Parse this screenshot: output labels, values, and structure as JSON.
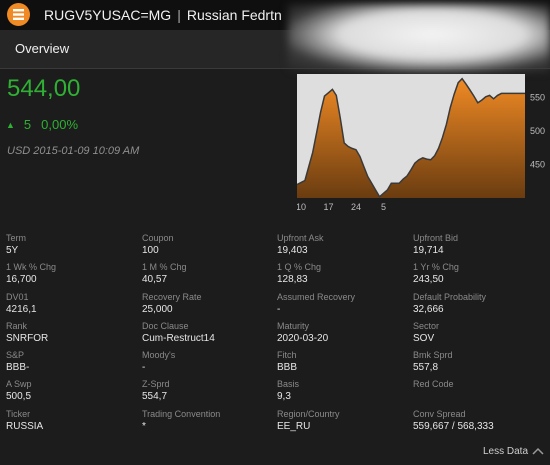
{
  "header": {
    "ticker": "RUGV5YUSAC=MG",
    "separator": "|",
    "name": "Russian Fedrtn"
  },
  "nav": {
    "overview_label": "Overview"
  },
  "quote": {
    "price": "544,00",
    "change": "5",
    "change_pct": "0,00%",
    "timestamp": "USD  2015-01-09 10:09 AM",
    "up_color": "#2fb034"
  },
  "chart_data": {
    "type": "area",
    "x_ticks": [
      "10",
      "17",
      "24",
      "5"
    ],
    "y_ticks": [
      "450",
      "500",
      "550"
    ],
    "ylim": [
      400,
      585
    ],
    "x": [
      0,
      1,
      2,
      3,
      4,
      5,
      6,
      7,
      8,
      9,
      10,
      11,
      12,
      13,
      14,
      15,
      16,
      17,
      18,
      19,
      20,
      21,
      22,
      23,
      24,
      25,
      26,
      27,
      28,
      29,
      30,
      31,
      32,
      33,
      34,
      35,
      36,
      37,
      38,
      39,
      40,
      41,
      42,
      43,
      44,
      45,
      46,
      47,
      48,
      49,
      50,
      51,
      52,
      53,
      54,
      55,
      56,
      57,
      58
    ],
    "values": [
      420,
      423,
      426,
      447,
      468,
      498,
      528,
      552,
      557,
      562,
      553,
      520,
      482,
      477,
      474,
      472,
      462,
      447,
      432,
      422,
      412,
      402,
      407,
      412,
      422,
      422,
      422,
      428,
      433,
      442,
      452,
      457,
      460,
      458,
      457,
      463,
      474,
      490,
      510,
      535,
      555,
      572,
      578,
      570,
      561,
      552,
      542,
      546,
      551,
      553,
      548,
      553,
      556,
      556,
      556,
      556,
      556,
      556,
      556
    ],
    "fill_color": "#f08a24",
    "line_color": "#3a3a3a",
    "grid": false
  },
  "fields": [
    {
      "label": "Term",
      "value": "5Y"
    },
    {
      "label": "Coupon",
      "value": "100"
    },
    {
      "label": "Upfront Ask",
      "value": "19,403"
    },
    {
      "label": "Upfront Bid",
      "value": "19,714"
    },
    {
      "label": "1 Wk % Chg",
      "value": "16,700"
    },
    {
      "label": "1 M % Chg",
      "value": "40,57"
    },
    {
      "label": "1 Q % Chg",
      "value": "128,83"
    },
    {
      "label": "1 Yr % Chg",
      "value": "243,50"
    },
    {
      "label": "DV01",
      "value": "4216,1"
    },
    {
      "label": "Recovery Rate",
      "value": "25,000"
    },
    {
      "label": "Assumed Recovery",
      "value": "-"
    },
    {
      "label": "Default Probability",
      "value": "32,666"
    },
    {
      "label": "Rank",
      "value": "SNRFOR"
    },
    {
      "label": "Doc Clause",
      "value": "Cum-Restruct14"
    },
    {
      "label": "Maturity",
      "value": "2020-03-20"
    },
    {
      "label": "Sector",
      "value": "SOV"
    },
    {
      "label": "S&P",
      "value": "BBB-"
    },
    {
      "label": "Moody's",
      "value": "-"
    },
    {
      "label": "Fitch",
      "value": "BBB"
    },
    {
      "label": "Bmk Sprd",
      "value": "557,8"
    },
    {
      "label": "A Swp",
      "value": "500,5"
    },
    {
      "label": "Z-Sprd",
      "value": "554,7"
    },
    {
      "label": "Basis",
      "value": "9,3"
    },
    {
      "label": "Red Code",
      "value": ""
    },
    {
      "label": "Ticker",
      "value": "RUSSIA"
    },
    {
      "label": "Trading Convention",
      "value": "*"
    },
    {
      "label": "Region/Country",
      "value": "EE_RU"
    },
    {
      "label": "Conv Spread",
      "value": "559,667 / 568,333"
    }
  ],
  "footer": {
    "less_data_label": "Less Data"
  }
}
